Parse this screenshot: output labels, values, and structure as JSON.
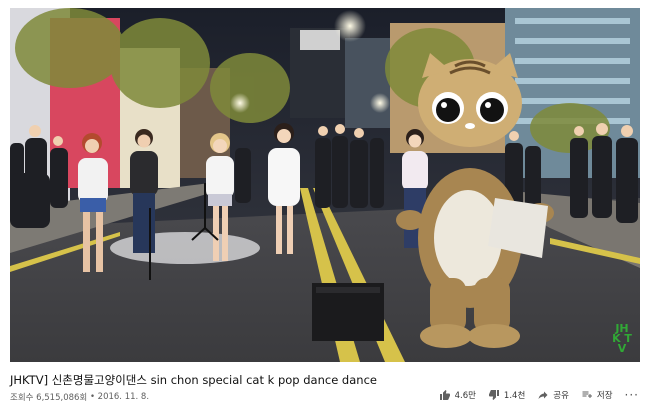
{
  "video": {
    "watermark": "JHK TV"
  },
  "title": "JHKTV] 신촌명물고양이댄스 sin chon special cat k pop dance dance",
  "meta": {
    "views": "조회수 6,515,086회",
    "separator": "•",
    "date": "2016. 11. 8."
  },
  "actions": {
    "like_count": "4.6만",
    "dislike_count": "1.4천",
    "share_label": "공유",
    "save_label": "저장",
    "more_label": "···"
  },
  "colors": {
    "brand_green": "#31a836",
    "brand_red": "#d42a20",
    "icon_gray": "#606060"
  }
}
